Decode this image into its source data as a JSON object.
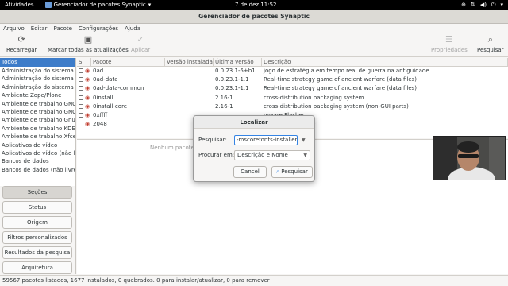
{
  "topbar": {
    "activities": "Atividades",
    "app_menu": "Gerenciador de pacotes Synaptic",
    "clock": "7 de dez  11:52"
  },
  "window": {
    "title": "Gerenciador de pacotes Synaptic"
  },
  "menubar": [
    "Arquivo",
    "Editar",
    "Pacote",
    "Configurações",
    "Ajuda"
  ],
  "toolbar": {
    "reload": "Recarregar",
    "mark_upgrades": "Marcar todas as atualizações",
    "apply": "Aplicar",
    "properties": "Propriedades",
    "search": "Pesquisar"
  },
  "left_panel": {
    "header": "Todos",
    "items": [
      "Administração do sistema",
      "Administração do sistema (contrib)",
      "Administração do sistema (não livre)",
      "Ambiente Zope/Plone",
      "Ambiente de trabalho GNOME",
      "Ambiente de trabalho GNOME (contrib)",
      "Ambiente de trabalho Gnustep",
      "Ambiente de trabalho KDE",
      "Ambiente de trabalho Xfce",
      "Aplicativos de vídeo",
      "Aplicativos de vídeo (não livre)",
      "Bancos de dados",
      "Bancos de dados (não livre)"
    ],
    "buttons": [
      "Seções",
      "Status",
      "Origem",
      "Filtros personalizados",
      "Resultados da pesquisa",
      "Arquitetura"
    ]
  },
  "table": {
    "columns": [
      "S",
      "",
      "Pacote",
      "Versão instalada",
      "Última versão",
      "Descrição"
    ],
    "rows": [
      {
        "name": "0ad",
        "installed": "",
        "latest": "0.0.23.1-5+b1",
        "desc": "jogo de estratégia em tempo real de guerra na antiguidade"
      },
      {
        "name": "0ad-data",
        "installed": "",
        "latest": "0.0.23.1-1.1",
        "desc": "Real-time strategy game of ancient warfare (data files)"
      },
      {
        "name": "0ad-data-common",
        "installed": "",
        "latest": "0.0.23.1-1.1",
        "desc": "Real-time strategy game of ancient warfare (data files)"
      },
      {
        "name": "0install",
        "installed": "",
        "latest": "2.16-1",
        "desc": "cross-distribution packaging system"
      },
      {
        "name": "0install-core",
        "installed": "",
        "latest": "2.16-1",
        "desc": "cross-distribution packaging system (non-GUI parts)"
      },
      {
        "name": "0xffff",
        "installed": "",
        "latest": "",
        "desc": "mware Flasher"
      },
      {
        "name": "2048",
        "installed": "",
        "latest": "",
        "desc": "ame for text mode"
      }
    ]
  },
  "description_pane": {
    "placeholder": "Nenhum pacote selecionado."
  },
  "statusbar": "59567 pacotes listados, 1677 instalados, 0 quebrados. 0 para instalar/atualizar, 0 para remover",
  "dialog": {
    "title": "Localizar",
    "search_label": "Pesquisar:",
    "search_value": "-mscorefonts-installer",
    "search_in_label": "Procurar em:",
    "search_in_value": "Descrição e Nome",
    "cancel": "Cancel",
    "search_button": "Pesquisar"
  },
  "colors": {
    "selection": "#3d7cc9",
    "focus": "#3584e4"
  }
}
